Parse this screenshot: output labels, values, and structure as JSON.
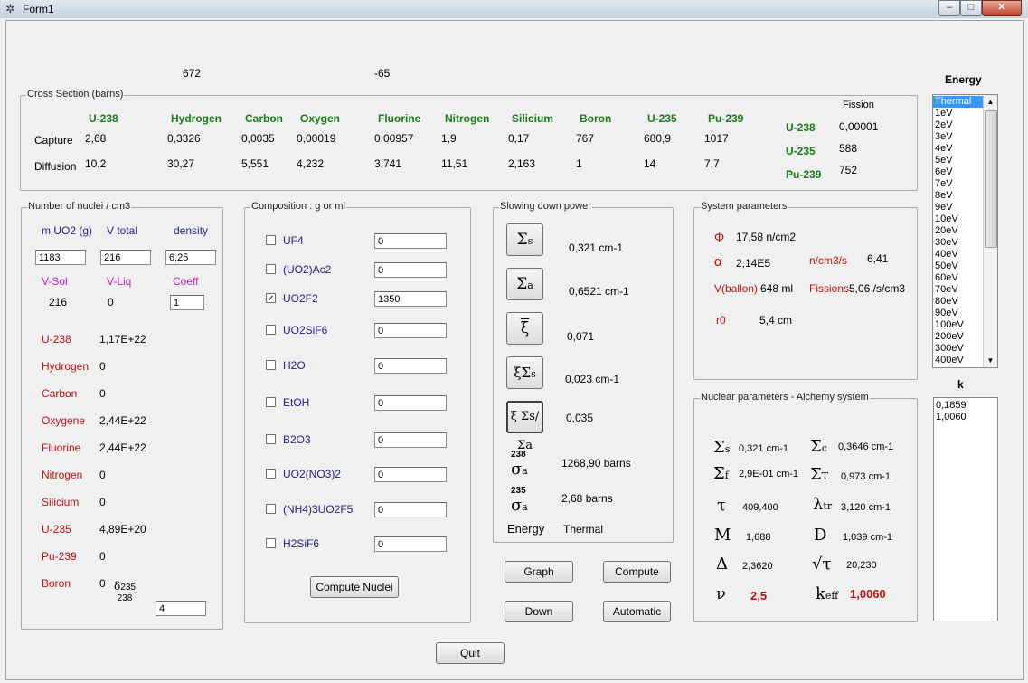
{
  "window": {
    "title": "Form1",
    "minimize": "‒",
    "maximize": "□",
    "close": "✕",
    "icon": "atom-icon"
  },
  "top_values": {
    "v1": "672",
    "v2": "-65"
  },
  "cross_section": {
    "title": "Cross Section (barns)",
    "headers": [
      "U-238",
      "Hydrogen",
      "Carbon",
      "Oxygen",
      "Fluorine",
      "Nitrogen",
      "Silicium",
      "Boron",
      "U-235",
      "Pu-239"
    ],
    "capture_label": "Capture",
    "diffusion_label": "Diffusion",
    "capture": [
      "2,68",
      "0,3326",
      "0,0035",
      "0,00019",
      "0,00957",
      "1,9",
      "0,17",
      "767",
      "680,9",
      "1017"
    ],
    "diffusion": [
      "10,2",
      "30,27",
      "5,551",
      "4,232",
      "3,741",
      "11,51",
      "2,163",
      "1",
      "14",
      "7,7"
    ],
    "fission_label": "Fission",
    "fission": [
      {
        "name": "U-238",
        "value": "0,00001"
      },
      {
        "name": "U-235",
        "value": "588"
      },
      {
        "name": "Pu-239",
        "value": "752"
      }
    ]
  },
  "nuclei": {
    "title": "Number of nuclei / cm3",
    "labels1": [
      "m UO2 (g)",
      "V total",
      "density"
    ],
    "values1": [
      "1183",
      "216",
      "6,25"
    ],
    "labels2": [
      "V-Sol",
      "V-Liq",
      "Coeff"
    ],
    "vsol": "216",
    "vliq": "0",
    "coeff": "1",
    "items": [
      {
        "name": "U-238",
        "value": "1,17E+22"
      },
      {
        "name": "Hydrogen",
        "value": "0"
      },
      {
        "name": "Carbon",
        "value": "0"
      },
      {
        "name": "Oxygene",
        "value": "2,44E+22"
      },
      {
        "name": "Fluorine",
        "value": "2,44E+22"
      },
      {
        "name": "Nitrogen",
        "value": "0"
      },
      {
        "name": "Silicium",
        "value": "0"
      },
      {
        "name": "U-235",
        "value": "4,89E+20"
      },
      {
        "name": "Pu-239",
        "value": "0"
      },
      {
        "name": "Boron",
        "value": "0"
      }
    ],
    "delta_sym": "δ",
    "delta_sub": "235",
    "delta_den": "238",
    "delta_value": "4"
  },
  "composition": {
    "title": "Composition : g or ml",
    "items": [
      {
        "name": "UF4",
        "value": "0",
        "checked": false
      },
      {
        "name": "(UO2)Ac2",
        "value": "0",
        "checked": false
      },
      {
        "name": "UO2F2",
        "value": "1350",
        "checked": true
      },
      {
        "name": "UO2SiF6",
        "value": "0",
        "checked": false
      },
      {
        "name": "H2O",
        "value": "0",
        "checked": false
      },
      {
        "name": "EtOH",
        "value": "0",
        "checked": false
      },
      {
        "name": "B2O3",
        "value": "0",
        "checked": false
      },
      {
        "name": "UO2(NO3)2",
        "value": "0",
        "checked": false
      },
      {
        "name": "(NH4)3UO2F5",
        "value": "0",
        "checked": false
      },
      {
        "name": "H2SiF6",
        "value": "0",
        "checked": false
      }
    ],
    "button": "Compute Nuclei"
  },
  "slowing": {
    "title": "Slowing down power",
    "rows": [
      "0,321  cm-1",
      "0,6521  cm-1",
      "0,071",
      "0,023  cm-1",
      "0,035"
    ],
    "sigma238_sup": "238",
    "sigma238": "1268,90  barns",
    "sigma235_sup": "235",
    "sigma235": "2,68  barns",
    "energy_label": "Energy",
    "energy_value": "Thermal"
  },
  "system": {
    "title": "System parameters",
    "phi_sym": "Φ",
    "phi": "17,58  n/cm2",
    "alpha_sym": "α",
    "alpha": "2,14E5",
    "ncm3s_label": "n/cm3/s",
    "ncm3s": "6,41",
    "vballon_label": "V(ballon)",
    "vballon": "648  ml",
    "fissions_label": "Fissions",
    "fissions": "5,06  /s/cm3",
    "r0_label": "r0",
    "r0": "5,4  cm"
  },
  "nuclear": {
    "title": "Nuclear parameters - Alchemy system",
    "sigma_s": "0,321  cm-1",
    "sigma_c": "0,3646  cm-1",
    "sigma_f": "2,9E-01  cm-1",
    "sigma_t": "0,973  cm-1",
    "tau": "409,400",
    "lambda_tr": "3,120  cm-1",
    "M": "1,688",
    "D": "1,039  cm-1",
    "Delta": "2,3620",
    "sqrt_tau": "20,230",
    "nu": "2,5",
    "keff": "1,0060"
  },
  "buttons": {
    "graph": "Graph",
    "compute": "Compute",
    "down": "Down",
    "automatic": "Automatic",
    "quit": "Quit"
  },
  "energy": {
    "title": "Energy",
    "items": [
      "Thermal",
      "1eV",
      "2eV",
      "3eV",
      "4eV",
      "5eV",
      "6eV",
      "7eV",
      "8eV",
      "9eV",
      "10eV",
      "20eV",
      "30eV",
      "40eV",
      "50eV",
      "60eV",
      "70eV",
      "80eV",
      "90eV",
      "100eV",
      "200eV",
      "300eV",
      "400eV"
    ]
  },
  "k": {
    "title": "k",
    "values": [
      "0,1859",
      "1,0060"
    ]
  }
}
